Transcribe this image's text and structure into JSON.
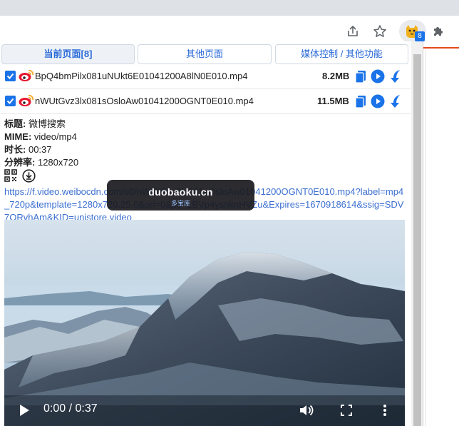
{
  "browser": {
    "ext_badge_count": "8"
  },
  "popup": {
    "tabs": [
      {
        "label": "当前页面[8]",
        "active": true
      },
      {
        "label": "其他页面",
        "active": false
      },
      {
        "label": "媒体控制 / 其他功能",
        "active": false
      }
    ],
    "files": [
      {
        "checked": true,
        "name": "BpQ4bmPilx081uNUkt6E01041200A8lN0E010.mp4",
        "size": "8.2MB"
      },
      {
        "checked": true,
        "name": "nWUtGvz3lx081sOsloAw01041200OGNT0E010.mp4",
        "size": "11.5MB"
      }
    ],
    "info": {
      "title_label": "标题:",
      "title_value": "微博搜索",
      "mime_label": "MIME:",
      "mime_value": "video/mp4",
      "duration_label": "时长:",
      "duration_value": "00:37",
      "resolution_label": "分辨率:",
      "resolution_value": "1280x720"
    },
    "url": "https://f.video.weibocdn.com/o0/nWUtGvz3lx081sOsloAw01041200OGNT0E010.mp4?label=mp4_720p&template=1280x720.25.0&ori=0&ps=1BVp4ysnknHVZu&Expires=1670918614&ssig=SDV7ORvhAm&KID=unistore,video",
    "player": {
      "time": "0:00 / 0:37"
    }
  },
  "watermark": {
    "main": "duobaoku.cn",
    "sub": "多宝库"
  },
  "colors": {
    "accent": "#1a73e8",
    "link": "#3b6fd1",
    "weibo_red": "#e6162d"
  }
}
